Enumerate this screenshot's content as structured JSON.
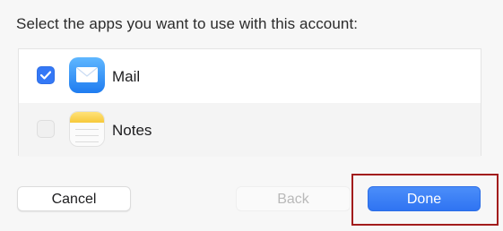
{
  "dialog": {
    "heading": "Select the apps you want to use with this account:"
  },
  "apps": [
    {
      "label": "Mail",
      "checked": true,
      "icon": "mail-icon"
    },
    {
      "label": "Notes",
      "checked": false,
      "icon": "notes-icon"
    }
  ],
  "buttons": {
    "cancel_label": "Cancel",
    "back_label": "Back",
    "done_label": "Done"
  },
  "colors": {
    "accent": "#3478f6",
    "highlight": "#a21c1c"
  }
}
